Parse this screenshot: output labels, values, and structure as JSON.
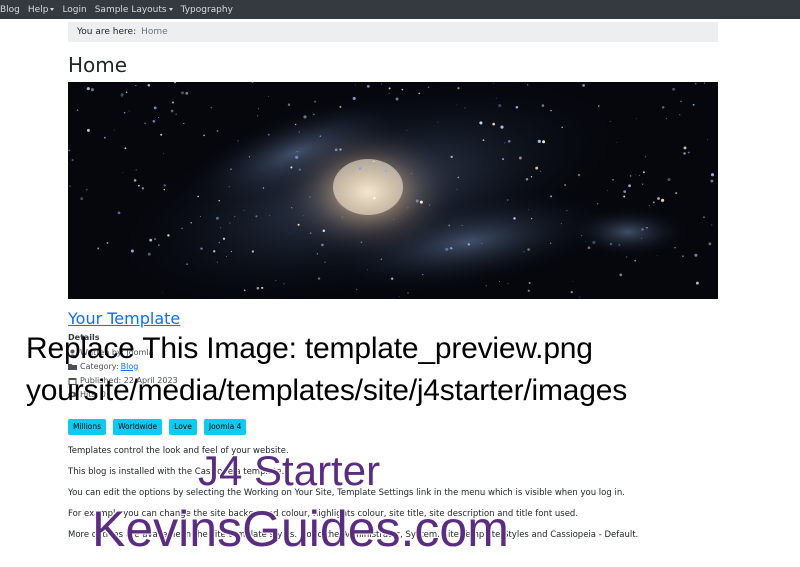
{
  "nav": {
    "items": [
      {
        "label": "Blog",
        "dropdown": false
      },
      {
        "label": "Help",
        "dropdown": true
      },
      {
        "label": "Login",
        "dropdown": false
      },
      {
        "label": "Sample Layouts",
        "dropdown": true
      },
      {
        "label": "Typography",
        "dropdown": false
      }
    ]
  },
  "breadcrumb": {
    "label": "You are here:",
    "current": "Home"
  },
  "page": {
    "title": "Home"
  },
  "article": {
    "title": "Your Template",
    "details_heading": "Details",
    "author_label": "Written by: Joomla",
    "category_label": "Category:",
    "category_link": "Blog",
    "published_label": "Published: 22 April 2023",
    "hits_label": "Hits: 0",
    "tags": [
      "Millions",
      "Worldwide",
      "Love",
      "Joomla 4"
    ],
    "paragraphs": [
      "Templates control the look and feel of your website.",
      "This blog is installed with the Cassiopeia template.",
      "You can edit the options by selecting the Working on Your Site, Template Settings link in the menu which is visible when you log in.",
      "For example you can change the site background colour, highlights colour, site title, site description and title font used.",
      "More options are available in the site template styles. Go to the Administrator, System, Site Template Styles and Cassiopeia - Default."
    ]
  },
  "overlay": {
    "line1": "Replace This Image: template_preview.png",
    "line2": "yoursite/media/templates/site/j4starter/images",
    "brand1": "J4 Starter",
    "brand2": "KevinsGuides.com"
  },
  "colors": {
    "navbar": "#343a40",
    "link": "#0d6efd",
    "tag": "#0dcaf0",
    "brand": "#5b2d82"
  },
  "icons": [
    "user-icon",
    "folder-icon",
    "calendar-icon",
    "eye-icon"
  ]
}
